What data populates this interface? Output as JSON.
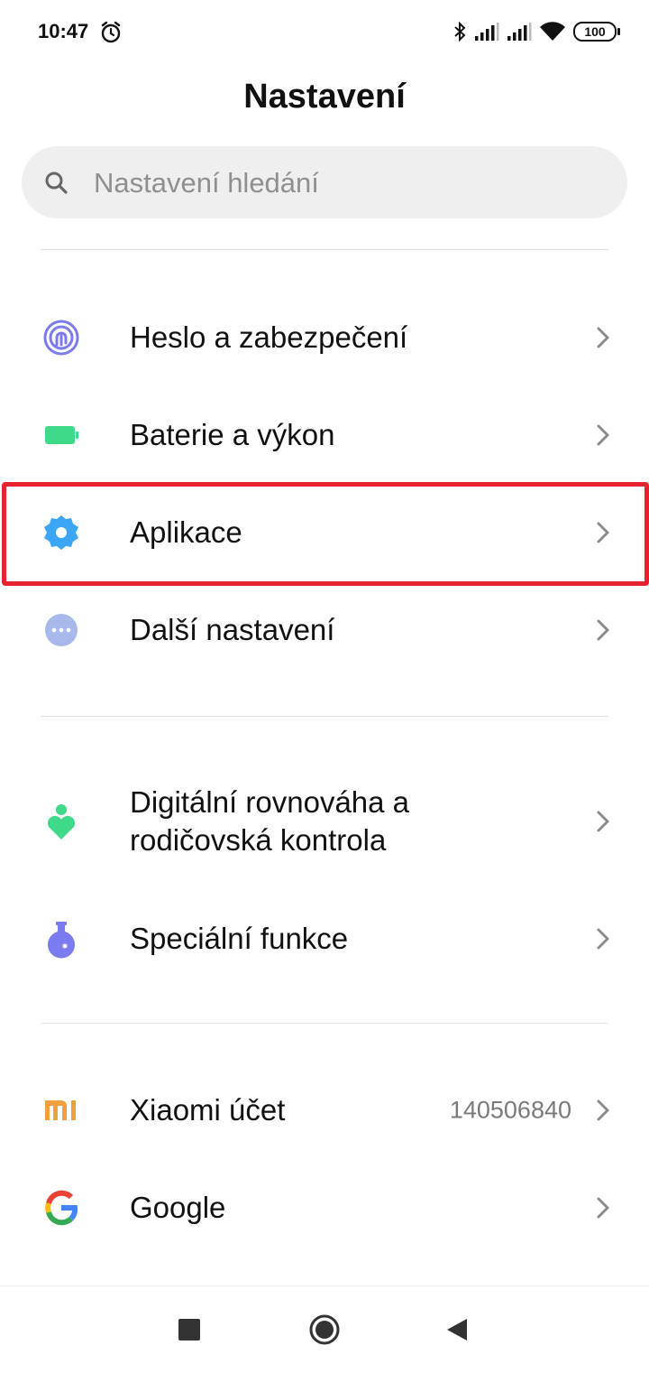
{
  "status_bar": {
    "time": "10:47",
    "battery": "100",
    "icons": [
      "alarm-icon",
      "bluetooth-icon",
      "signal-icon",
      "signal-icon",
      "wifi-icon",
      "battery-icon"
    ]
  },
  "header": {
    "title": "Nastavení"
  },
  "search": {
    "placeholder": "Nastavení hledání",
    "value": ""
  },
  "groups": [
    {
      "items": [
        {
          "label": "Heslo a zabezpečení",
          "icon": "fingerprint-icon",
          "color": "#7b7bf0"
        },
        {
          "label": "Baterie a výkon",
          "icon": "battery-icon",
          "color": "#3fd98a"
        },
        {
          "label": "Aplikace",
          "icon": "gear-icon",
          "color": "#3aa6f5",
          "highlighted": true
        },
        {
          "label": "Další nastavení",
          "icon": "more-dots-icon",
          "color": "#a7b8ea"
        }
      ]
    },
    {
      "items": [
        {
          "label_line1": "Digitální rovnováha a",
          "label_line2": "rodičovská kontrola",
          "icon": "person-heart-icon",
          "color": "#3fd98a"
        },
        {
          "label": "Speciální funkce",
          "icon": "flask-icon",
          "color": "#7b7bf0"
        }
      ]
    },
    {
      "items": [
        {
          "label": "Xiaomi účet",
          "value": "140506840",
          "icon": "mi-logo-icon",
          "color": "#f0a03c"
        },
        {
          "label": "Google",
          "icon": "google-logo-icon"
        }
      ]
    }
  ],
  "highlight_color": "#e8222e",
  "nav_bar": {
    "buttons": [
      "recents-button",
      "home-button",
      "back-button"
    ]
  }
}
